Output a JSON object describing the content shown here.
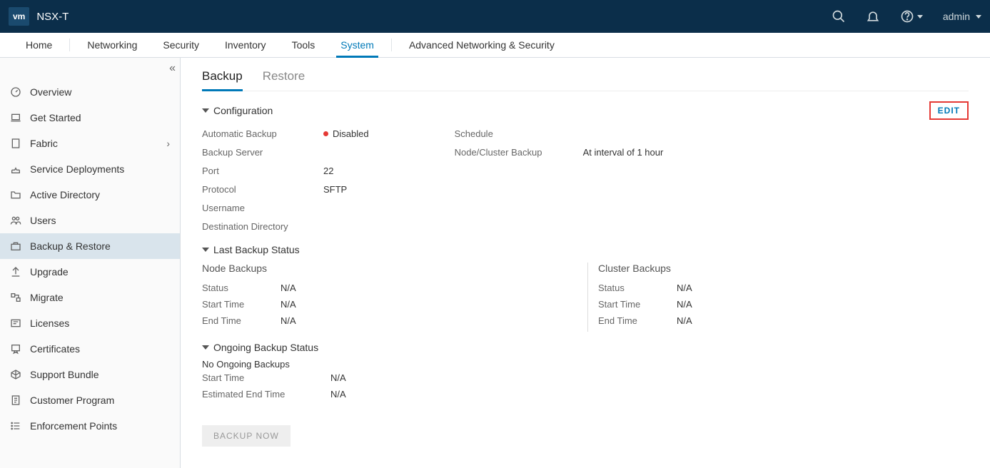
{
  "app": {
    "logo": "vm",
    "title": "NSX-T",
    "user": "admin"
  },
  "topnav": {
    "items": [
      "Home",
      "Networking",
      "Security",
      "Inventory",
      "Tools",
      "System",
      "Advanced Networking & Security"
    ],
    "active_index": 5
  },
  "sidebar": {
    "items": [
      {
        "label": "Overview",
        "icon": "gauge"
      },
      {
        "label": "Get Started",
        "icon": "laptop"
      },
      {
        "label": "Fabric",
        "icon": "server",
        "has_children": true
      },
      {
        "label": "Service Deployments",
        "icon": "deploy"
      },
      {
        "label": "Active Directory",
        "icon": "folder"
      },
      {
        "label": "Users",
        "icon": "users"
      },
      {
        "label": "Backup & Restore",
        "icon": "backup",
        "active": true
      },
      {
        "label": "Upgrade",
        "icon": "upgrade"
      },
      {
        "label": "Migrate",
        "icon": "migrate"
      },
      {
        "label": "Licenses",
        "icon": "license"
      },
      {
        "label": "Certificates",
        "icon": "cert"
      },
      {
        "label": "Support Bundle",
        "icon": "package"
      },
      {
        "label": "Customer Program",
        "icon": "doc"
      },
      {
        "label": "Enforcement Points",
        "icon": "list"
      }
    ]
  },
  "subtabs": {
    "items": [
      "Backup",
      "Restore"
    ],
    "active_index": 0
  },
  "configuration": {
    "section_title": "Configuration",
    "edit_label": "EDIT",
    "auto_backup_label": "Automatic Backup",
    "auto_backup_status": "Disabled",
    "backup_server_label": "Backup Server",
    "backup_server_value": "",
    "port_label": "Port",
    "port_value": "22",
    "protocol_label": "Protocol",
    "protocol_value": "SFTP",
    "username_label": "Username",
    "username_value": "",
    "dest_label": "Destination Directory",
    "dest_value": "",
    "schedule_label": "Schedule",
    "node_cluster_label": "Node/Cluster Backup",
    "node_cluster_value": "At interval of 1 hour"
  },
  "last_backup": {
    "section_title": "Last Backup Status",
    "node": {
      "title": "Node Backups",
      "status_label": "Status",
      "status_value": "N/A",
      "start_label": "Start Time",
      "start_value": "N/A",
      "end_label": "End Time",
      "end_value": "N/A"
    },
    "cluster": {
      "title": "Cluster Backups",
      "status_label": "Status",
      "status_value": "N/A",
      "start_label": "Start Time",
      "start_value": "N/A",
      "end_label": "End Time",
      "end_value": "N/A"
    }
  },
  "ongoing": {
    "section_title": "Ongoing Backup Status",
    "none_msg": "No Ongoing Backups",
    "start_label": "Start Time",
    "start_value": "N/A",
    "est_label": "Estimated End Time",
    "est_value": "N/A"
  },
  "backup_now_label": "BACKUP NOW"
}
